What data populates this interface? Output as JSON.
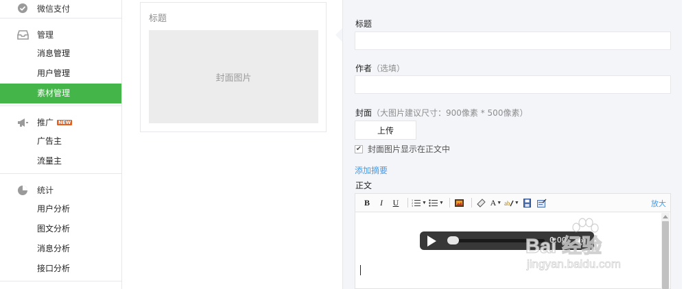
{
  "sidebar": {
    "payment": {
      "label": "微信支付",
      "icon": "wechat-pay-icon"
    },
    "manage": {
      "label": "管理",
      "icon": "inbox-icon",
      "items": [
        "消息管理",
        "用户管理",
        "素材管理"
      ],
      "active_index": 2
    },
    "promote": {
      "label": "推广",
      "icon": "megaphone-icon",
      "badge": "NEW",
      "items": [
        "广告主",
        "流量主"
      ]
    },
    "stats": {
      "label": "统计",
      "icon": "pie-chart-icon",
      "items": [
        "用户分析",
        "图文分析",
        "消息分析",
        "接口分析"
      ]
    },
    "accent_color": "#44b549"
  },
  "preview": {
    "title_placeholder": "标题",
    "cover_placeholder": "封面图片"
  },
  "form": {
    "title_label": "标题",
    "title_value": "",
    "author_label": "作者",
    "author_hint": "（选填）",
    "author_value": "",
    "cover_label": "封面",
    "cover_hint": "（大图片建议尺寸：900像素 * 500像素）",
    "upload_label": "上传",
    "show_cover_checkbox": {
      "label": "封面图片显示在正文中",
      "checked": true,
      "mark": "✔"
    },
    "add_summary_link": "添加摘要",
    "body_label": "正文"
  },
  "editor": {
    "toolbar": {
      "bold": "B",
      "italic": "I",
      "underline": "U",
      "font_color": "A",
      "zoom_link": "放大"
    },
    "audio_player": {
      "time": "0:00"
    }
  },
  "watermark": {
    "text": "Bai 经验",
    "sub": "jingyan.baidu.com"
  },
  "colors": {
    "link": "#459ae9",
    "panel_bg": "#f4f5f9",
    "badge": "#e15f21"
  }
}
